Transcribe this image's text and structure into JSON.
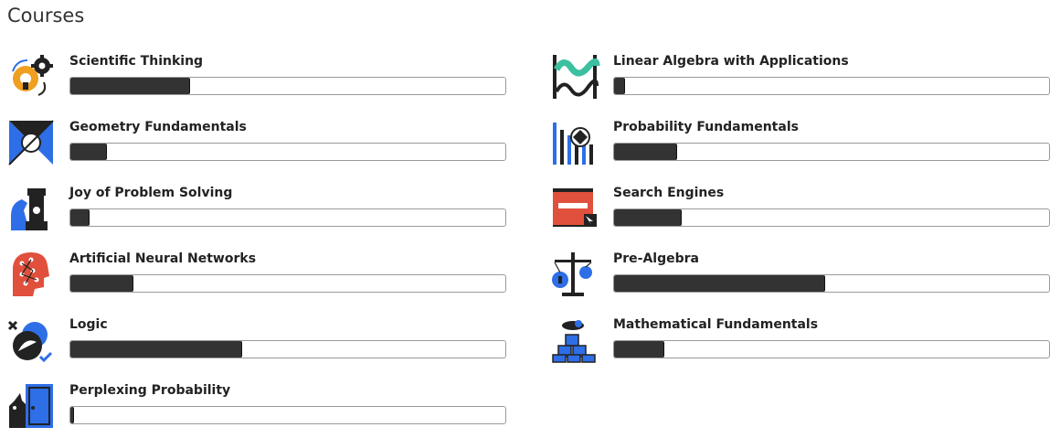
{
  "page": {
    "title": "Courses"
  },
  "courses": [
    {
      "name": "Scientific Thinking",
      "icon": "scientific-thinking-icon",
      "progress": 0.275
    },
    {
      "name": "Linear Algebra with Applications",
      "icon": "linear-algebra-icon",
      "progress": 0.025
    },
    {
      "name": "Geometry Fundamentals",
      "icon": "geometry-icon",
      "progress": 0.085
    },
    {
      "name": "Probability Fundamentals",
      "icon": "probability-icon",
      "progress": 0.145
    },
    {
      "name": "Joy of Problem Solving",
      "icon": "problem-solving-icon",
      "progress": 0.045
    },
    {
      "name": "Search Engines",
      "icon": "search-engines-icon",
      "progress": 0.155
    },
    {
      "name": "Artificial Neural Networks",
      "icon": "neural-networks-icon",
      "progress": 0.145
    },
    {
      "name": "Pre-Algebra",
      "icon": "pre-algebra-icon",
      "progress": 0.485
    },
    {
      "name": "Logic",
      "icon": "logic-icon",
      "progress": 0.395
    },
    {
      "name": "Mathematical Fundamentals",
      "icon": "mathematical-fundamentals-icon",
      "progress": 0.115
    },
    {
      "name": "Perplexing Probability",
      "icon": "perplexing-probability-icon",
      "progress": 0.008
    }
  ],
  "colors": {
    "accent_blue": "#2e6ee6",
    "accent_red": "#e0503c",
    "accent_orange": "#f0a020",
    "accent_teal": "#3cc0a0",
    "bar_fill": "#333333"
  }
}
